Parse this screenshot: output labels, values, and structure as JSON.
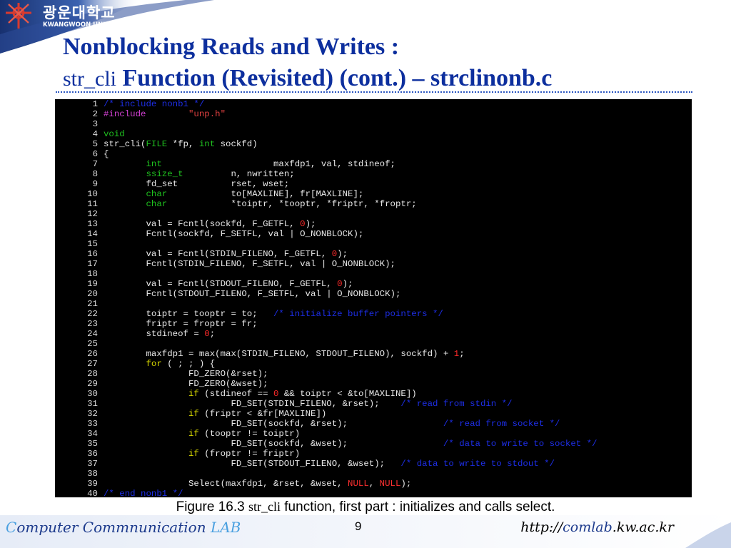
{
  "header": {
    "logo_korean": "광운대학교",
    "logo_english": "KWANGWOON UNIVERSITY",
    "logo_icon": "kwangwoon-emblem-icon"
  },
  "title": {
    "line1": "Nonblocking Reads and Writes :",
    "line2_func": "str_cli",
    "line2_rest": " Function (Revisited) (cont.) – strclinonb.c"
  },
  "code": {
    "lines": [
      {
        "n": "1",
        "parts": [
          [
            "cm",
            "/* include nonb1 */"
          ]
        ]
      },
      {
        "n": "2",
        "parts": [
          [
            "pp",
            "#include"
          ],
          [
            "",
            "        "
          ],
          [
            "st",
            "\"unp.h\""
          ]
        ]
      },
      {
        "n": "3",
        "parts": []
      },
      {
        "n": "4",
        "parts": [
          [
            "ty",
            "void"
          ]
        ]
      },
      {
        "n": "5",
        "parts": [
          [
            "",
            "str_cli("
          ],
          [
            "ty",
            "FILE"
          ],
          [
            "",
            " *fp, "
          ],
          [
            "ty",
            "int"
          ],
          [
            "",
            " sockfd)"
          ]
        ]
      },
      {
        "n": "6",
        "parts": [
          [
            "",
            "{"
          ]
        ]
      },
      {
        "n": "7",
        "parts": [
          [
            "",
            "        "
          ],
          [
            "ty",
            "int"
          ],
          [
            "",
            "                     maxfdp1, val, stdineof;"
          ]
        ]
      },
      {
        "n": "8",
        "parts": [
          [
            "",
            "        "
          ],
          [
            "ty",
            "ssize_t"
          ],
          [
            "",
            "         n, nwritten;"
          ]
        ]
      },
      {
        "n": "9",
        "parts": [
          [
            "",
            "        fd_set          rset, wset;"
          ]
        ]
      },
      {
        "n": "10",
        "parts": [
          [
            "",
            "        "
          ],
          [
            "ty",
            "char"
          ],
          [
            "",
            "            to[MAXLINE], fr[MAXLINE];"
          ]
        ]
      },
      {
        "n": "11",
        "parts": [
          [
            "",
            "        "
          ],
          [
            "ty",
            "char"
          ],
          [
            "",
            "            *toiptr, *tooptr, *friptr, *froptr;"
          ]
        ]
      },
      {
        "n": "12",
        "parts": []
      },
      {
        "n": "13",
        "parts": [
          [
            "",
            "        val = Fcntl(sockfd, F_GETFL, "
          ],
          [
            "nu",
            "0"
          ],
          [
            "",
            ");"
          ]
        ]
      },
      {
        "n": "14",
        "parts": [
          [
            "",
            "        Fcntl(sockfd, F_SETFL, val | O_NONBLOCK);"
          ]
        ]
      },
      {
        "n": "15",
        "parts": []
      },
      {
        "n": "16",
        "parts": [
          [
            "",
            "        val = Fcntl(STDIN_FILENO, F_GETFL, "
          ],
          [
            "nu",
            "0"
          ],
          [
            "",
            ");"
          ]
        ]
      },
      {
        "n": "17",
        "parts": [
          [
            "",
            "        Fcntl(STDIN_FILENO, F_SETFL, val | O_NONBLOCK);"
          ]
        ]
      },
      {
        "n": "18",
        "parts": []
      },
      {
        "n": "19",
        "parts": [
          [
            "",
            "        val = Fcntl(STDOUT_FILENO, F_GETFL, "
          ],
          [
            "nu",
            "0"
          ],
          [
            "",
            ");"
          ]
        ]
      },
      {
        "n": "20",
        "parts": [
          [
            "",
            "        Fcntl(STDOUT_FILENO, F_SETFL, val | O_NONBLOCK);"
          ]
        ]
      },
      {
        "n": "21",
        "parts": []
      },
      {
        "n": "22",
        "parts": [
          [
            "",
            "        toiptr = tooptr = to;   "
          ],
          [
            "cm",
            "/* initialize buffer pointers */"
          ]
        ]
      },
      {
        "n": "23",
        "parts": [
          [
            "",
            "        friptr = froptr = fr;"
          ]
        ]
      },
      {
        "n": "24",
        "parts": [
          [
            "",
            "        stdineof = "
          ],
          [
            "nu",
            "0"
          ],
          [
            "",
            ";"
          ]
        ]
      },
      {
        "n": "25",
        "parts": []
      },
      {
        "n": "26",
        "parts": [
          [
            "",
            "        maxfdp1 = max(max(STDIN_FILENO, STDOUT_FILENO), sockfd) + "
          ],
          [
            "nu",
            "1"
          ],
          [
            "",
            ";"
          ]
        ]
      },
      {
        "n": "27",
        "parts": [
          [
            "",
            "        "
          ],
          [
            "kw",
            "for"
          ],
          [
            "",
            " ( ; ; ) {"
          ]
        ]
      },
      {
        "n": "28",
        "parts": [
          [
            "",
            "                FD_ZERO(&rset);"
          ]
        ]
      },
      {
        "n": "29",
        "parts": [
          [
            "",
            "                FD_ZERO(&wset);"
          ]
        ]
      },
      {
        "n": "30",
        "parts": [
          [
            "",
            "                "
          ],
          [
            "kw",
            "if"
          ],
          [
            "",
            " (stdineof == "
          ],
          [
            "nu",
            "0"
          ],
          [
            "",
            " && toiptr < &to[MAXLINE])"
          ]
        ]
      },
      {
        "n": "31",
        "parts": [
          [
            "",
            "                        FD_SET(STDIN_FILENO, &rset);    "
          ],
          [
            "cm",
            "/* read from stdin */"
          ]
        ]
      },
      {
        "n": "32",
        "parts": [
          [
            "",
            "                "
          ],
          [
            "kw",
            "if"
          ],
          [
            "",
            " (friptr < &fr[MAXLINE])"
          ]
        ]
      },
      {
        "n": "33",
        "parts": [
          [
            "",
            "                        FD_SET(sockfd, &rset);                  "
          ],
          [
            "cm",
            "/* read from socket */"
          ]
        ]
      },
      {
        "n": "34",
        "parts": [
          [
            "",
            "                "
          ],
          [
            "kw",
            "if"
          ],
          [
            "",
            " (tooptr != toiptr)"
          ]
        ]
      },
      {
        "n": "35",
        "parts": [
          [
            "",
            "                        FD_SET(sockfd, &wset);                  "
          ],
          [
            "cm",
            "/* data to write to socket */"
          ]
        ]
      },
      {
        "n": "36",
        "parts": [
          [
            "",
            "                "
          ],
          [
            "kw",
            "if"
          ],
          [
            "",
            " (froptr != friptr)"
          ]
        ]
      },
      {
        "n": "37",
        "parts": [
          [
            "",
            "                        FD_SET(STDOUT_FILENO, &wset);   "
          ],
          [
            "cm",
            "/* data to write to stdout */"
          ]
        ]
      },
      {
        "n": "38",
        "parts": []
      },
      {
        "n": "39",
        "parts": [
          [
            "",
            "                Select(maxfdp1, &rset, &wset, "
          ],
          [
            "nl",
            "NULL"
          ],
          [
            "",
            ", "
          ],
          [
            "nl",
            "NULL"
          ],
          [
            "",
            ");"
          ]
        ]
      },
      {
        "n": "40",
        "parts": [
          [
            "cm",
            "/* end nonb1 */"
          ]
        ]
      }
    ]
  },
  "caption": {
    "prefix": "Figure 16.3 ",
    "func": "str_cli",
    "suffix": " function, first part : initializes and calls select."
  },
  "footer": {
    "left_c": "C",
    "left_rest1": "omputer Commnunication ",
    "left_lab": "LAB",
    "page": "9",
    "url_1": "http://",
    "url_2": "comlab",
    "url_3": ".kw.ac.kr"
  },
  "colors": {
    "title": "#0d2f9e",
    "banner": "#1c3a8c",
    "code_bg": "#000000"
  }
}
